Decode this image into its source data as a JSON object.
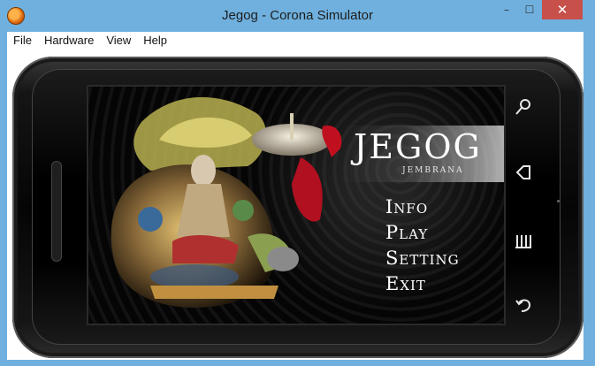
{
  "window": {
    "title": "Jegog - Corona Simulator",
    "controls": {
      "minimize": "–",
      "maximize": "☐",
      "close": "✕"
    }
  },
  "menubar": {
    "items": [
      {
        "label": "File"
      },
      {
        "label": "Hardware"
      },
      {
        "label": "View"
      },
      {
        "label": "Help"
      }
    ]
  },
  "app": {
    "brand_title": "JEGOG",
    "brand_subtitle": "JEMBRANA",
    "menu": [
      {
        "label": "Info"
      },
      {
        "label": "Play"
      },
      {
        "label": "Setting"
      },
      {
        "label": "Exit"
      }
    ]
  },
  "hardware_buttons": {
    "icons": [
      "search-icon",
      "home-icon",
      "menu-icon",
      "back-icon"
    ]
  },
  "colors": {
    "titlebar": "#6fb0de",
    "close": "#c7504a",
    "screen_bg": "#050505"
  }
}
